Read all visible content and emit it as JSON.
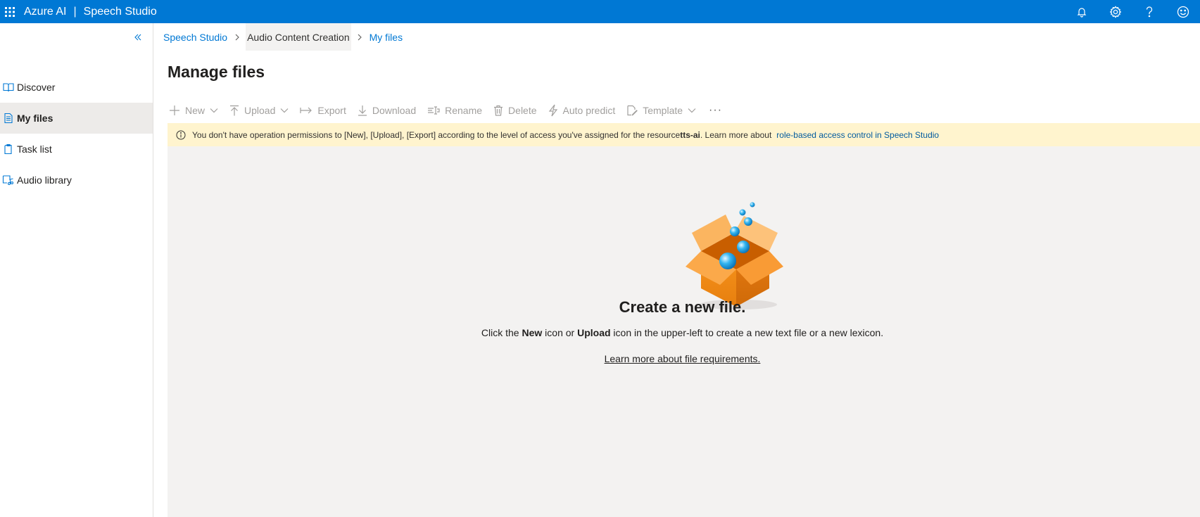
{
  "topbar": {
    "product": "Azure AI",
    "separator": "|",
    "app": "Speech Studio",
    "icons": [
      "notifications-icon",
      "settings-icon",
      "help-icon",
      "feedback-icon"
    ]
  },
  "sidebar": {
    "items": [
      {
        "label": "Discover",
        "icon": "book-icon",
        "active": false
      },
      {
        "label": "My files",
        "icon": "document-icon",
        "active": true
      },
      {
        "label": "Task list",
        "icon": "clipboard-icon",
        "active": false
      },
      {
        "label": "Audio library",
        "icon": "music-library-icon",
        "active": false
      }
    ]
  },
  "breadcrumb": {
    "items": [
      "Speech Studio",
      "Audio Content Creation",
      "My files"
    ]
  },
  "page": {
    "title": "Manage files"
  },
  "toolbar": {
    "new": "New",
    "upload": "Upload",
    "export": "Export",
    "download": "Download",
    "rename": "Rename",
    "delete": "Delete",
    "auto_predict": "Auto predict",
    "template": "Template",
    "more": "···"
  },
  "banner": {
    "text_before": "You don't have operation permissions to [New], [Upload], [Export] according to the level of access you've assigned for the resource ",
    "resource": "tts-ai",
    "text_after": ". Learn more about ",
    "link": "role-based access control in Speech Studio"
  },
  "empty_state": {
    "title": "Create a new file.",
    "desc_1": "Click the ",
    "desc_new": "New",
    "desc_2": " icon or ",
    "desc_upload": "Upload",
    "desc_3": " icon in the upper-left to create a new text file or a new lexicon.",
    "link": "Learn more about file requirements."
  },
  "colors": {
    "brand": "#0078d4",
    "banner_bg": "#fff4ce",
    "content_bg": "#f3f2f1",
    "box_orange": "#f7941d"
  }
}
